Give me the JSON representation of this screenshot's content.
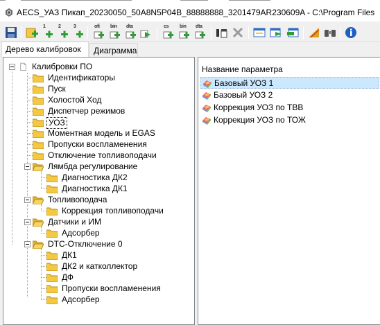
{
  "window": {
    "title": "AECS_УАЗ Пикап_20230050_50A8N5P04B_88888888_3201479AR230609A - C:\\Program Files"
  },
  "toolbar": {
    "buttons": [
      {
        "name": "save-icon",
        "badge": ""
      },
      {
        "name": "add-1-icon",
        "badge": "1"
      },
      {
        "name": "add-2-icon",
        "badge": "2"
      },
      {
        "name": "add-3-icon",
        "badge": "3"
      },
      {
        "name": "ofi-icon",
        "badge": "ofi"
      },
      {
        "name": "bin-icon",
        "badge": "bin"
      },
      {
        "name": "dta-icon",
        "badge": "dta"
      },
      {
        "name": "go-icon",
        "badge": ""
      },
      {
        "name": "cs-icon",
        "badge": "cs"
      },
      {
        "name": "bin-export-icon",
        "badge": "bin"
      },
      {
        "name": "dta-export-icon",
        "badge": "dta"
      },
      {
        "name": "compare-icon",
        "badge": ""
      },
      {
        "name": "disconnect-icon",
        "badge": ""
      },
      {
        "name": "window-icon",
        "badge": ""
      },
      {
        "name": "window-export-icon",
        "badge": ""
      },
      {
        "name": "window-import-icon",
        "badge": ""
      },
      {
        "name": "ramp-icon",
        "badge": ""
      },
      {
        "name": "binoculars-icon",
        "badge": ""
      },
      {
        "name": "info-icon",
        "badge": ""
      }
    ]
  },
  "tabs": [
    {
      "label": "Дерево калибровок",
      "active": true
    },
    {
      "label": "Диаграмма",
      "active": false
    }
  ],
  "tree": {
    "root": "Калибровки ПО",
    "items": [
      {
        "label": "Идентификаторы",
        "level": 1
      },
      {
        "label": "Пуск",
        "level": 1
      },
      {
        "label": "Холостой Ход",
        "level": 1
      },
      {
        "label": "Диспетчер режимов",
        "level": 1
      },
      {
        "label": "УОЗ",
        "level": 1,
        "selected": true
      },
      {
        "label": "Моментная модель и EGAS",
        "level": 1
      },
      {
        "label": "Пропуски воспламенения",
        "level": 1
      },
      {
        "label": "Отключение топливоподачи",
        "level": 1
      },
      {
        "label": "Лямбда регулирование",
        "level": 1,
        "expanded": true
      },
      {
        "label": "Диагностика ДК2",
        "level": 2
      },
      {
        "label": "Диагностика ДК1",
        "level": 2
      },
      {
        "label": "Топливоподача",
        "level": 1,
        "expanded": true
      },
      {
        "label": "Коррекция топливоподачи",
        "level": 2
      },
      {
        "label": "Датчики и ИМ",
        "level": 1,
        "expanded": true
      },
      {
        "label": "Адсорбер",
        "level": 2
      },
      {
        "label": "DTC-Отключение 0",
        "level": 1,
        "expanded": true
      },
      {
        "label": "ДК1",
        "level": 2
      },
      {
        "label": "ДК2 и катколлектор",
        "level": 2
      },
      {
        "label": "ДФ",
        "level": 2
      },
      {
        "label": "Пропуски воспламенения",
        "level": 2
      },
      {
        "label": "Адсорбер",
        "level": 2
      }
    ]
  },
  "params": {
    "header": "Название параметра",
    "items": [
      {
        "label": "Базовый УОЗ 1",
        "selected": true
      },
      {
        "label": "Базовый УОЗ 2",
        "selected": false
      },
      {
        "label": "Коррекция УОЗ по ТВВ",
        "selected": false
      },
      {
        "label": "Коррекция УОЗ по ТОЖ",
        "selected": false
      }
    ]
  },
  "colors": {
    "folder": "#f5c842",
    "selection": "#cce8ff",
    "accent": "#0078d7"
  }
}
